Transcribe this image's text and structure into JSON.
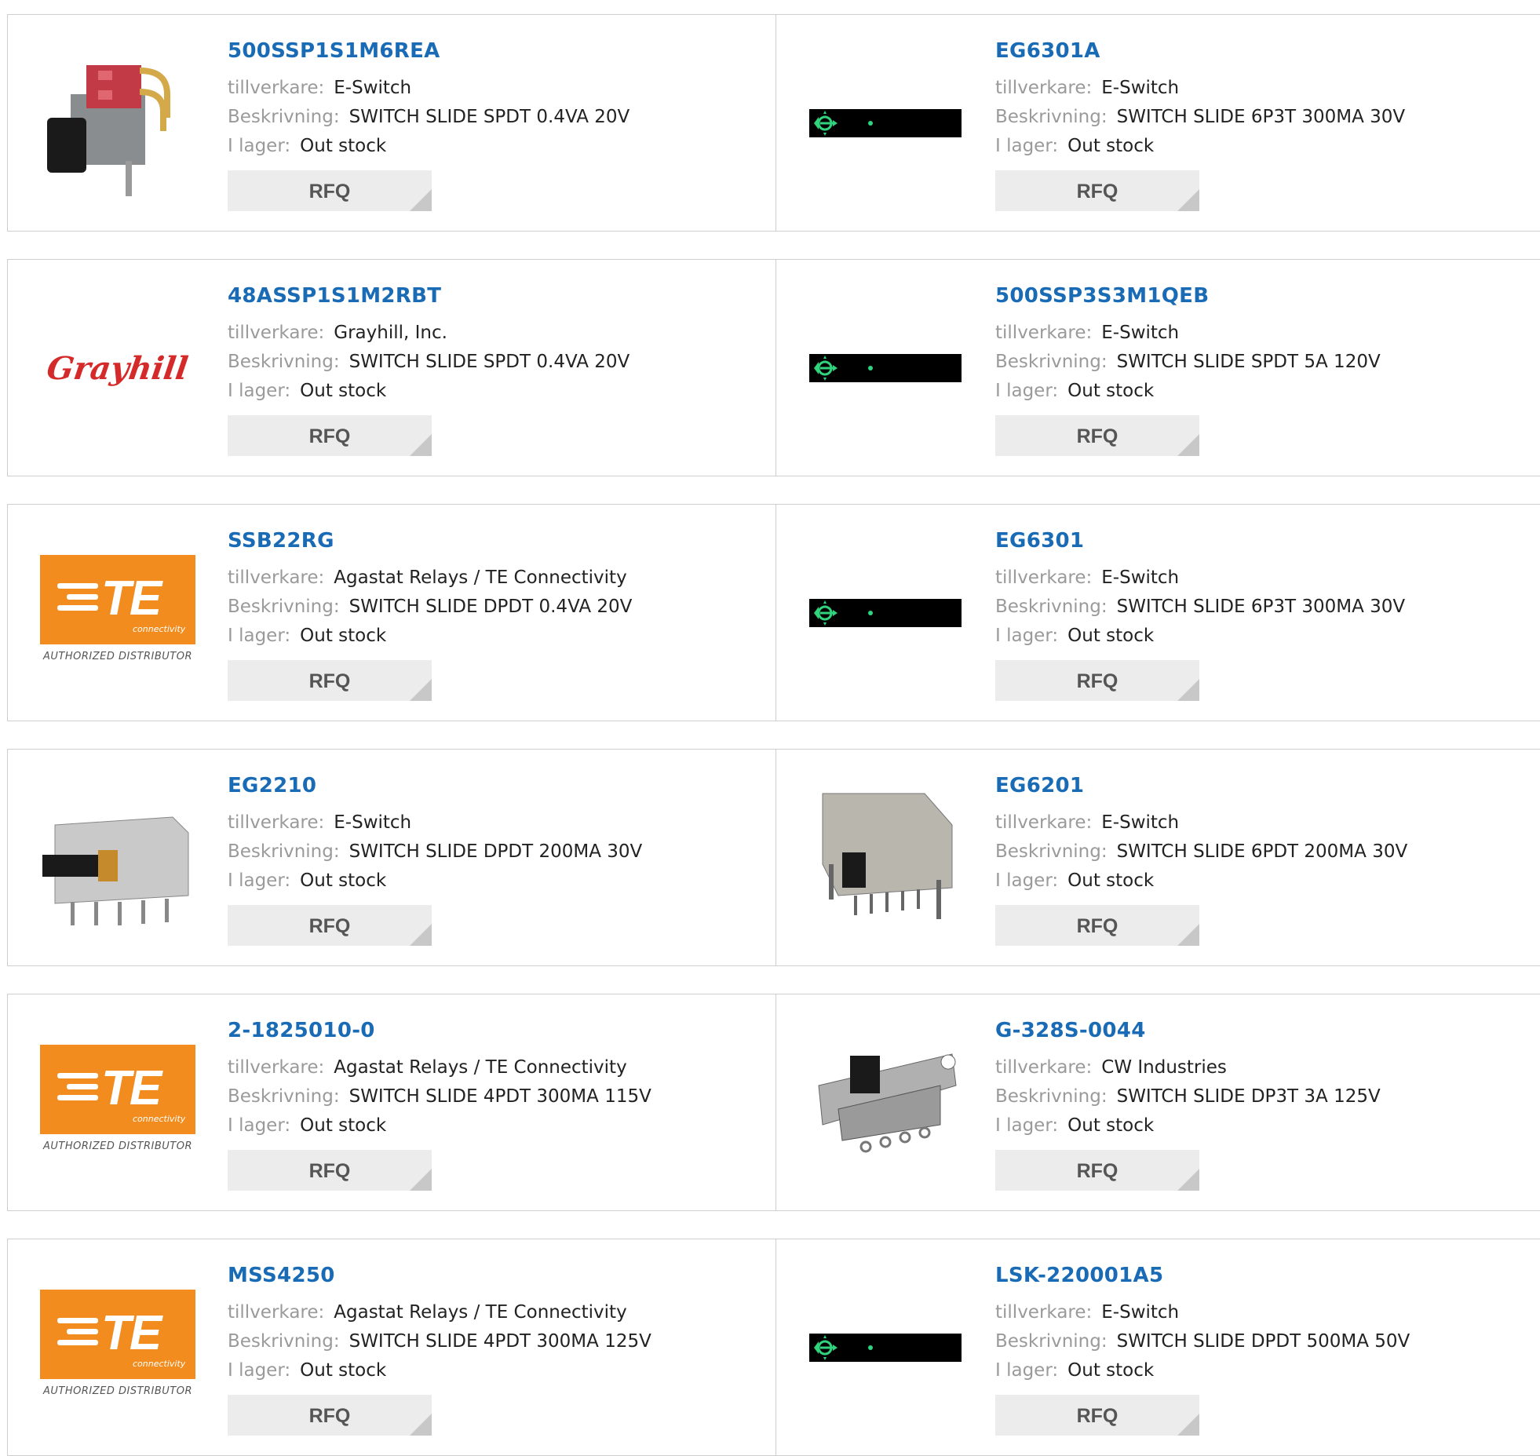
{
  "labels": {
    "manufacturer": "tillverkare:",
    "description": "Beskrivning:",
    "stock": "I lager:",
    "rfq": "RFQ"
  },
  "rows": [
    {
      "left": {
        "part": "500SSP1S1M6REA",
        "manufacturer": "E-Switch",
        "description": "SWITCH SLIDE SPDT 0.4VA 20V",
        "stock": "Out stock",
        "image": "slide-switch-red-photo"
      },
      "right": {
        "part": "EG6301A",
        "manufacturer": "E-Switch",
        "description": "SWITCH SLIDE 6P3T 300MA 30V",
        "stock": "Out stock",
        "image": "image-placeholder-icon"
      }
    },
    {
      "left": {
        "part": "48ASSP1S1M2RBT",
        "manufacturer": "Grayhill, Inc.",
        "description": "SWITCH SLIDE SPDT 0.4VA 20V",
        "stock": "Out stock",
        "image": "grayhill-logo",
        "logo_text": "Grayhill"
      },
      "right": {
        "part": "500SSP3S3M1QEB",
        "manufacturer": "E-Switch",
        "description": "SWITCH SLIDE SPDT 5A 120V",
        "stock": "Out stock",
        "image": "image-placeholder-icon"
      }
    },
    {
      "left": {
        "part": "SSB22RG",
        "manufacturer": "Agastat Relays / TE Connectivity",
        "description": "SWITCH SLIDE DPDT 0.4VA 20V",
        "stock": "Out stock",
        "image": "te-logo"
      },
      "right": {
        "part": "EG6301",
        "manufacturer": "E-Switch",
        "description": "SWITCH SLIDE 6P3T 300MA 30V",
        "stock": "Out stock",
        "image": "image-placeholder-icon"
      }
    },
    {
      "left": {
        "part": "EG2210",
        "manufacturer": "E-Switch",
        "description": "SWITCH SLIDE DPDT 200MA 30V",
        "stock": "Out stock",
        "image": "slide-switch-metal-photo"
      },
      "right": {
        "part": "EG6201",
        "manufacturer": "E-Switch",
        "description": "SWITCH SLIDE 6PDT 200MA 30V",
        "stock": "Out stock",
        "image": "slide-switch-long-photo"
      }
    },
    {
      "left": {
        "part": "2-1825010-0",
        "manufacturer": "Agastat Relays / TE Connectivity",
        "description": "SWITCH SLIDE 4PDT 300MA 115V",
        "stock": "Out stock",
        "image": "te-logo"
      },
      "right": {
        "part": "G-328S-0044",
        "manufacturer": "CW Industries",
        "description": "SWITCH SLIDE DP3T 3A 125V",
        "stock": "Out stock",
        "image": "slide-switch-bracket-photo"
      }
    },
    {
      "left": {
        "part": "MSS4250",
        "manufacturer": "Agastat Relays / TE Connectivity",
        "description": "SWITCH SLIDE 4PDT 300MA 125V",
        "stock": "Out stock",
        "image": "te-logo"
      },
      "right": {
        "part": "LSK-220001A5",
        "manufacturer": "E-Switch",
        "description": "SWITCH SLIDE DPDT 500MA 50V",
        "stock": "Out stock",
        "image": "image-placeholder-icon"
      }
    }
  ],
  "te_logo": {
    "brand": "TE",
    "sub": "connectivity",
    "caption": "AUTHORIZED DISTRIBUTOR"
  },
  "colors": {
    "link": "#1a6bb5",
    "label": "#9a9a9a",
    "te_orange": "#f28c1e",
    "grayhill_red": "#d42a2a",
    "border": "#cfcfcf",
    "rfq_bg": "#ececec"
  }
}
